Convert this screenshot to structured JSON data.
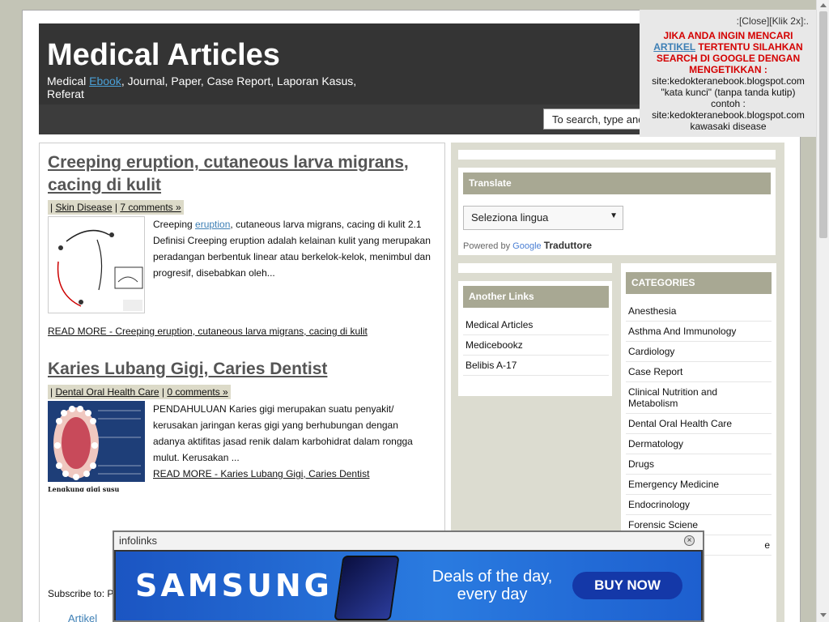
{
  "header": {
    "title": "Medical Articles",
    "desc_prefix": "Medical ",
    "desc_link": "Ebook",
    "desc_suffix": ", Journal, Paper, Case Report, Laporan Kasus, Referat"
  },
  "search": {
    "value": "To search, type and"
  },
  "posts": [
    {
      "title_line1": "Creeping eruption, cutaneous larva migrans,",
      "title_line2": "cacing di kulit",
      "meta_sep": "|",
      "category": "Skin Disease",
      "comments": "7 comments »",
      "text_prefix": "Creeping ",
      "text_link": "eruption",
      "text_suffix": ", cutaneous larva migrans, cacing di kulit 2.1 Definisi      Creeping eruption adalah kelainan kulit yang merupakan peradangan berbentuk linear atau berkelok-kelok, menimbul dan progresif, disebabkan oleh...",
      "read_more": "READ MORE - Creeping eruption, cutaneous larva migrans, cacing di kulit"
    },
    {
      "title": "Karies Lubang Gigi, Caries Dentist",
      "meta_sep": "|",
      "category": "Dental Oral Health Care",
      "comments": "0 comments »",
      "text": "PENDAHULUAN          Karies gigi merupakan suatu penyakit/ kerusakan jaringan keras gigi yang berhubungan dengan adanya aktifitas jasad renik dalam karbohidrat dalam rongga mulut. Kerusakan ...",
      "read_more": "READ MORE - Karies Lubang Gigi, Caries Dentist",
      "image_caption": "Lengkung gigi susu"
    }
  ],
  "subscribe_label": "Subscribe to: P",
  "artikel_label": "Artikel",
  "translate": {
    "heading": "Translate",
    "select_value": "Seleziona lingua",
    "powered_by": "Powered by",
    "google": "Google",
    "traduttore": "Traduttore"
  },
  "another_links": {
    "heading": "Another Links",
    "items": [
      "Medical Articles",
      "Medicebookz",
      "Belibis A-17"
    ]
  },
  "categories": {
    "heading": "CATEGORIES",
    "items": [
      "Anesthesia",
      "Asthma And Immunology",
      "Cardiology",
      "Case Report",
      "Clinical Nutrition and Metabolism",
      "Dental Oral Health Care",
      "Dermatology",
      "Drugs",
      "Emergency Medicine",
      "Endocrinology",
      "Forensic Sciene"
    ],
    "partial_item": "e"
  },
  "overlay": {
    "close": ":[Close][Klik 2x]:.",
    "line1": "JIKA ANDA INGIN MENCARI",
    "link": "ARTIKEL",
    "line2": " TERTENTU SILAHKAN SEARCH DI GOOGLE DENGAN MENGETIKKAN :",
    "site": "site:kedokteranebook.blogspot.com",
    "kata": "\"kata kunci\" (tanpa tanda kutip)",
    "contoh": "contoh :",
    "example": "site:kedokteranebook.blogspot.com kawasaki disease"
  },
  "ad": {
    "brand": "infolinks",
    "close": "×",
    "samsung": "SAMSUNG",
    "deals": "Deals of the day, every day",
    "buy": "BUY NOW"
  },
  "colors": {
    "header_bg": "#343434",
    "sidebar_bg": "#dcdcd0",
    "widget_head": "#a8a893",
    "overlay_red": "#d40000",
    "link_blue": "#3d7fb5"
  }
}
